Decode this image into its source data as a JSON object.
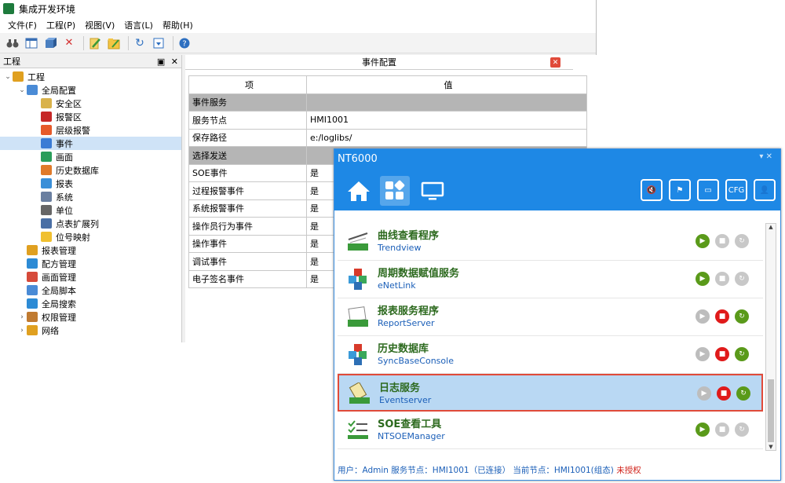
{
  "ide": {
    "title": "集成开发环境",
    "menu": [
      "文件(F)",
      "工程(P)",
      "视图(V)",
      "语言(L)",
      "帮助(H)"
    ],
    "toolbar_icons": [
      "binoculars-icon",
      "table-icon",
      "cube-icon",
      "delete-icon",
      "edit-icon",
      "folder-edit-icon",
      "refresh-icon",
      "export-icon",
      "help-icon"
    ],
    "left_pane": {
      "title": "工程",
      "pin": "▣",
      "close": "✕",
      "tree": [
        {
          "label": "工程",
          "level": 0,
          "expand": "v",
          "color": "#e0a020"
        },
        {
          "label": "全局配置",
          "level": 1,
          "expand": "v",
          "color": "#4a8bd6"
        },
        {
          "label": "安全区",
          "level": 2,
          "color": "#d9b24a"
        },
        {
          "label": "报警区",
          "level": 2,
          "color": "#c62828"
        },
        {
          "label": "层级报警",
          "level": 2,
          "color": "#e65a2a"
        },
        {
          "label": "事件",
          "level": 2,
          "color": "#3a7bd5",
          "selected": true
        },
        {
          "label": "画面",
          "level": 2,
          "color": "#2a9d5a"
        },
        {
          "label": "历史数据库",
          "level": 2,
          "color": "#e07a2a"
        },
        {
          "label": "报表",
          "level": 2,
          "color": "#3a8fd8"
        },
        {
          "label": "系统",
          "level": 2,
          "color": "#6a7fa0"
        },
        {
          "label": "单位",
          "level": 2,
          "color": "#666666"
        },
        {
          "label": "点表扩展列",
          "level": 2,
          "color": "#4a6fa5"
        },
        {
          "label": "位号映射",
          "level": 2,
          "color": "#f0c030"
        },
        {
          "label": "报表管理",
          "level": 1,
          "color": "#e0a020"
        },
        {
          "label": "配方管理",
          "level": 1,
          "color": "#2d8bd5"
        },
        {
          "label": "画面管理",
          "level": 1,
          "color": "#d64a3a"
        },
        {
          "label": "全局脚本",
          "level": 1,
          "color": "#4a8bd6"
        },
        {
          "label": "全局搜索",
          "level": 1,
          "color": "#2d8bd5"
        },
        {
          "label": "权限管理",
          "level": 1,
          "expand": ">",
          "color": "#c07a30"
        },
        {
          "label": "网络",
          "level": 1,
          "expand": ">",
          "color": "#e0a020"
        }
      ]
    },
    "doc": {
      "title": "事件配置",
      "close": "✕",
      "columns": [
        "项",
        "值"
      ],
      "rows": [
        {
          "item": "事件服务",
          "value": "",
          "group": true
        },
        {
          "item": "服务节点",
          "value": "HMI1001"
        },
        {
          "item": "保存路径",
          "value": "e:/loglibs/"
        },
        {
          "item": "选择发送",
          "value": "",
          "group": true
        },
        {
          "item": "SOE事件",
          "value": "是"
        },
        {
          "item": "过程报警事件",
          "value": "是"
        },
        {
          "item": "系统报警事件",
          "value": "是"
        },
        {
          "item": "操作员行为事件",
          "value": "是"
        },
        {
          "item": "操作事件",
          "value": "是"
        },
        {
          "item": "调试事件",
          "value": "是"
        },
        {
          "item": "电子签名事件",
          "value": "是"
        }
      ]
    }
  },
  "nt": {
    "title": "NT6000",
    "win_controls": "▾ ✕",
    "nav": [
      "home-icon",
      "apps-icon",
      "monitor-icon"
    ],
    "right_icons": [
      {
        "name": "mute-icon",
        "text": "🔇"
      },
      {
        "name": "alarm-icon",
        "text": "⚑"
      },
      {
        "name": "screen-icon",
        "text": "▭"
      },
      {
        "name": "cfg-icon",
        "text": "CFG"
      },
      {
        "name": "user-icon",
        "text": "👤"
      }
    ],
    "services": [
      {
        "name": "曲线查看程序",
        "sub": "Trendview",
        "play": true,
        "stop": false,
        "restart": false,
        "highlight": false,
        "icon": "chart"
      },
      {
        "name": "周期数据赋值服务",
        "sub": "eNetLink",
        "play": true,
        "stop": false,
        "restart": false,
        "highlight": false,
        "icon": "blocks"
      },
      {
        "name": "报表服务程序",
        "sub": "ReportServer",
        "play": false,
        "stop": true,
        "restart": true,
        "highlight": false,
        "icon": "report"
      },
      {
        "name": "历史数据库",
        "sub": "SyncBaseConsole",
        "play": false,
        "stop": true,
        "restart": true,
        "highlight": false,
        "icon": "blocks"
      },
      {
        "name": "日志服务",
        "sub": "Eventserver",
        "play": false,
        "stop": true,
        "restart": true,
        "highlight": true,
        "icon": "log"
      },
      {
        "name": "SOE查看工具",
        "sub": "NTSOEManager",
        "play": true,
        "stop": false,
        "restart": false,
        "highlight": false,
        "icon": "soe"
      }
    ],
    "status": {
      "text": "用户：Admin  服务节点：HMI1001（已连接）  当前节点：HMI1001(组态) ",
      "warn": "未授权"
    }
  }
}
